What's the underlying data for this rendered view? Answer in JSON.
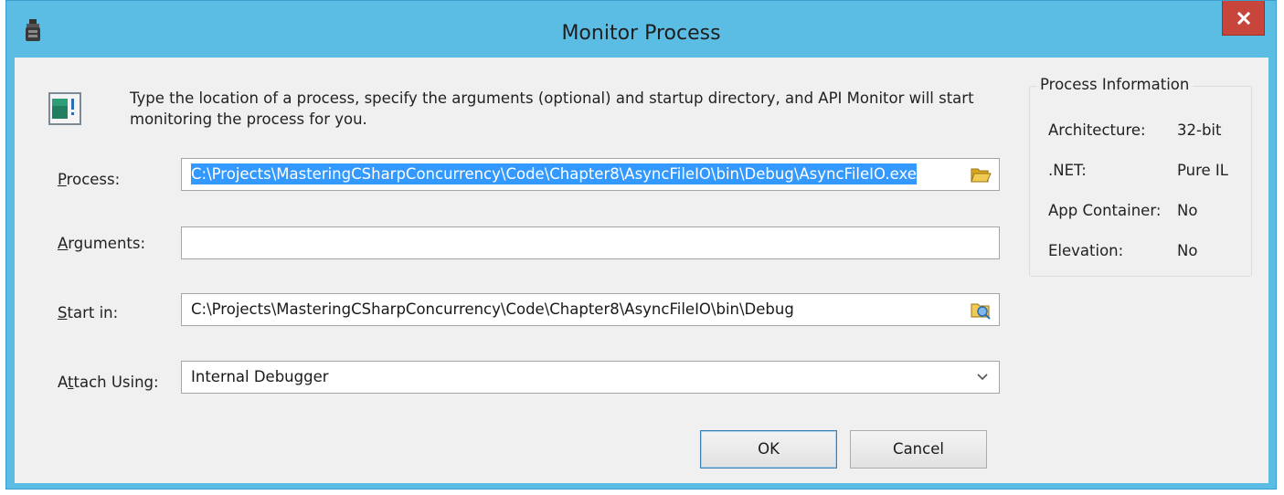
{
  "window": {
    "title": "Monitor Process",
    "close_label": "x",
    "accent_color": "#5cbde4",
    "close_color": "#c7453a"
  },
  "intro_text": "Type the location of a process, specify the arguments (optional) and startup directory, and API Monitor will start monitoring the process for you.",
  "form": {
    "process": {
      "label_accel": "P",
      "label_rest": "rocess:",
      "value": "C:\\Projects\\MasteringCSharpConcurrency\\Code\\Chapter8\\AsyncFileIO\\bin\\Debug\\AsyncFileIO.exe",
      "button_icon": "folder-open-icon"
    },
    "arguments": {
      "label_accel": "A",
      "label_rest": "rguments:",
      "value": ""
    },
    "start_in": {
      "label_accel": "S",
      "label_rest": "tart in:",
      "value": "C:\\Projects\\MasteringCSharpConcurrency\\Code\\Chapter8\\AsyncFileIO\\bin\\Debug",
      "button_icon": "browse-folder-icon"
    },
    "attach_using": {
      "label_pre": "A",
      "label_accel": "t",
      "label_rest": "tach Using:",
      "value": "Internal Debugger",
      "arrow_icon": "chevron-down-icon"
    }
  },
  "process_info": {
    "title": "Process Information",
    "rows": [
      {
        "key": "Architecture:",
        "value": "32-bit"
      },
      {
        "key": ".NET:",
        "value": "Pure IL"
      },
      {
        "key": "App Container:",
        "value": "No"
      },
      {
        "key": "Elevation:",
        "value": "No"
      }
    ]
  },
  "buttons": {
    "ok": "OK",
    "cancel": "Cancel"
  }
}
